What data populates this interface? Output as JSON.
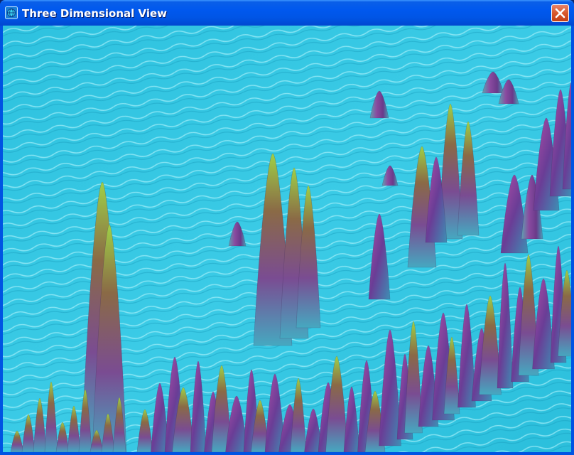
{
  "window": {
    "title": "Three Dimensional View",
    "icon": "app-globe-icon",
    "close_icon": "close-x-icon"
  },
  "viewport": {
    "content": "3d-surface-render",
    "colors": {
      "water": "#36c9e3",
      "water_highlight": "#9ff0fb",
      "spike_purple": "#8a4ba0",
      "spike_green": "#8fcf3a",
      "spike_brown": "#8a6a46"
    }
  },
  "colors": {
    "titlebar": "#0055e5",
    "close_button": "#d8582c",
    "frame": "#0054e3"
  }
}
